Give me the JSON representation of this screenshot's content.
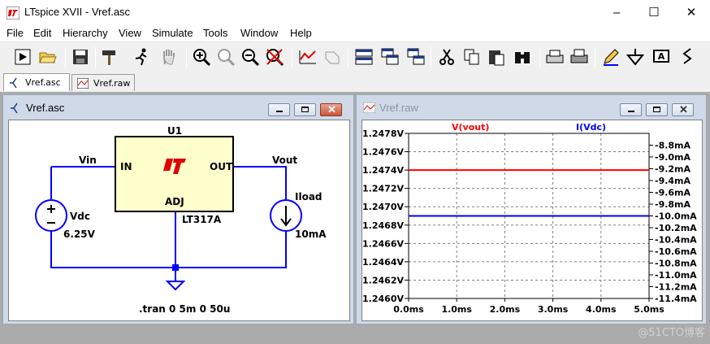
{
  "window": {
    "title": "LTspice XVII - Vref.asc",
    "minimize": "–",
    "maximize": "☐",
    "close": "✕"
  },
  "menu": [
    "File",
    "Edit",
    "Hierarchy",
    "View",
    "Simulate",
    "Tools",
    "Window",
    "Help"
  ],
  "tabs": [
    {
      "label": "Vref.asc",
      "active": true
    },
    {
      "label": "Vref.raw",
      "active": false
    }
  ],
  "schematic": {
    "title": "Vref.asc",
    "reg_name": "U1",
    "reg_in": "IN",
    "reg_out": "OUT",
    "reg_adj": "ADJ",
    "reg_model": "LT317A",
    "logo": "LT",
    "net_vin": "Vin",
    "net_vout": "Vout",
    "vsource_name": "Vdc",
    "vsource_value": "6.25V",
    "isource_name": "Iload",
    "isource_value": "10mA",
    "directive": ".tran 0 5m 0 50u"
  },
  "plot": {
    "title": "Vref.raw",
    "trace_labels": [
      "V(vout)",
      "I(Vdc)"
    ],
    "trace_colors": [
      "#ff0000",
      "#0000ff"
    ]
  },
  "chart_data": {
    "type": "line",
    "x": [
      0,
      5
    ],
    "xlim": [
      0,
      5
    ],
    "xticks": [
      "0.0ms",
      "1.0ms",
      "2.0ms",
      "3.0ms",
      "4.0ms",
      "5.0ms"
    ],
    "ylim": [
      1.246,
      1.2478
    ],
    "yticks_left": [
      "1.2478V",
      "1.2476V",
      "1.2474V",
      "1.2472V",
      "1.2470V",
      "1.2468V",
      "1.2466V",
      "1.2464V",
      "1.2462V",
      "1.2460V"
    ],
    "y2lim": [
      -11.4,
      -8.6
    ],
    "yticks_right": [
      "-8.8mA",
      "-9.0mA",
      "-9.2mA",
      "-9.4mA",
      "-9.6mA",
      "-9.8mA",
      "-10.0mA",
      "-10.2mA",
      "-10.4mA",
      "-10.6mA",
      "-10.8mA",
      "-11.0mA",
      "-11.2mA",
      "-11.4mA"
    ],
    "grid": true,
    "series": [
      {
        "name": "V(vout)",
        "axis": "left",
        "values": [
          1.2474,
          1.2474
        ]
      },
      {
        "name": "I(Vdc)",
        "axis": "right",
        "values": [
          -10.0,
          -10.0
        ]
      }
    ]
  },
  "watermark": "@51CTO博客"
}
